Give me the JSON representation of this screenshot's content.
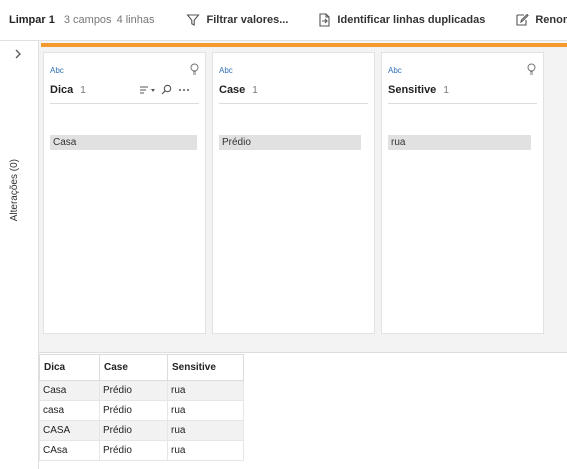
{
  "toolbar": {
    "title": "Limpar 1",
    "fields_count": "3 campos",
    "rows_count": "4 linhas",
    "filter_label": "Filtrar valores...",
    "duplicates_label": "Identificar linhas duplicadas",
    "rename_label": "Renomear campos"
  },
  "left_panel": {
    "changes_label": "Alterações (0)"
  },
  "accent_color": "#f29a2e",
  "type_color": "#2f6fb5",
  "fields": [
    {
      "type": "Abc",
      "name": "Dica",
      "count": "1",
      "value": "Casa"
    },
    {
      "type": "Abc",
      "name": "Case",
      "count": "1",
      "value": "Prédio"
    },
    {
      "type": "Abc",
      "name": "Sensitive",
      "count": "1",
      "value": "rua"
    }
  ],
  "grid": {
    "columns": [
      "Dica",
      "Case",
      "Sensitive"
    ],
    "rows": [
      [
        "Casa",
        "Prédio",
        "rua"
      ],
      [
        "casa",
        "Prédio",
        "rua"
      ],
      [
        "CASA",
        "Prédio",
        "rua"
      ],
      [
        "CAsa",
        "Prédio",
        "rua"
      ]
    ]
  }
}
